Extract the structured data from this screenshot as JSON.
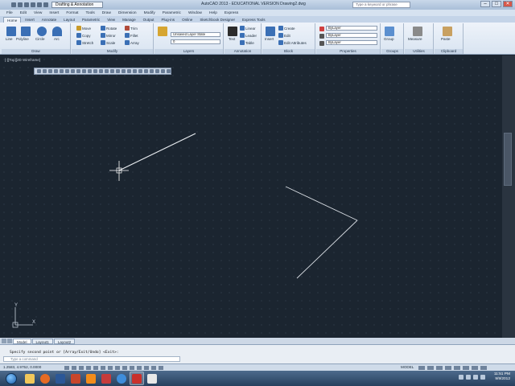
{
  "titlebar": {
    "workspace": "Drafting & Annotation",
    "title": "AutoCAD 2013 - EDUCATIONAL VERSION    Drawing2.dwg",
    "search_placeholder": "Type a keyword or phrase",
    "minimize": "–",
    "maximize": "□",
    "close": "✕"
  },
  "menubar": [
    "File",
    "Edit",
    "View",
    "Insert",
    "Format",
    "Tools",
    "Draw",
    "Dimension",
    "Modify",
    "Parametric",
    "Window",
    "Help",
    "Express"
  ],
  "ribbon_tabs": [
    "Home",
    "Insert",
    "Annotate",
    "Layout",
    "Parametric",
    "View",
    "Manage",
    "Output",
    "Plug-ins",
    "Online",
    "Sketchbook Designer",
    "Express Tools"
  ],
  "ribbon": {
    "draw": {
      "title": "Draw",
      "line": "Line",
      "polyline": "Polyline",
      "circle": "Circle",
      "arc": "Arc"
    },
    "modify": {
      "title": "Modify",
      "move": "Move",
      "rotate": "Rotate",
      "trim": "Trim",
      "copy": "Copy",
      "mirror": "Mirror",
      "fillet": "Fillet",
      "stretch": "Stretch",
      "scale": "Scale",
      "array": "Array"
    },
    "layers": {
      "title": "Layers",
      "layer_state": "Unsaved Layer State",
      "current_layer": "0"
    },
    "annotation": {
      "title": "Annotation",
      "text": "Text",
      "linear": "Linear",
      "leader": "Leader",
      "table": "Table"
    },
    "block": {
      "title": "Block",
      "insert": "Insert",
      "create": "Create",
      "edit": "Edit",
      "edit_attributes": "Edit Attributes"
    },
    "properties": {
      "title": "Properties",
      "color": "ByLayer",
      "linetype": "ByLayer",
      "lineweight": "ByLayer"
    },
    "groups": {
      "title": "Groups",
      "group": "Group"
    },
    "utilities": {
      "title": "Utilities",
      "measure": "Measure"
    },
    "clipboard": {
      "title": "Clipboard",
      "paste": "Paste"
    }
  },
  "viewport": {
    "label": "[-][Top][2D Wireframe]"
  },
  "ucs": {
    "y_label": "Y",
    "x_label": "X"
  },
  "layout_tabs": [
    "Model",
    "Layout1",
    "Layout2"
  ],
  "command": {
    "history": "Specify second point or [Array/Exit/Undo] <Exit>:",
    "prompt_placeholder": "Type a command"
  },
  "statusbar": {
    "coords": "1.2583, 4.9752, 0.0000",
    "model_label": "MODEL"
  },
  "taskbar": {
    "time": "11:51 PM",
    "date": "9/9/2012"
  },
  "colors": {
    "viewport_bg": "#1b2530",
    "line_color": "#e8ecf0",
    "ribbon_bg": "#eef3fa"
  }
}
